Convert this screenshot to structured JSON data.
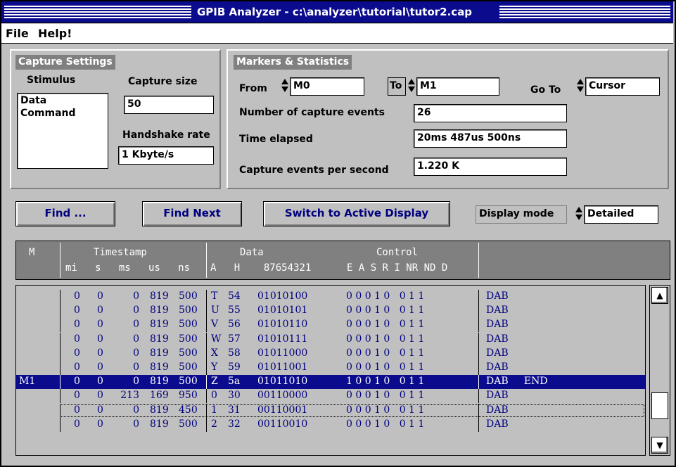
{
  "window": {
    "title": "GPIB Analyzer - c:\\analyzer\\tutorial\\tutor2.cap"
  },
  "menu": [
    {
      "label": "File"
    },
    {
      "label": "Help!"
    }
  ],
  "capture_settings": {
    "title": "Capture Settings",
    "stimulus_label": "Stimulus",
    "stimulus_items": [
      "Data",
      "Command"
    ],
    "capture_size_label": "Capture size",
    "capture_size_value": "50",
    "handshake_label": "Handshake rate",
    "handshake_value": "1 Kbyte/s"
  },
  "markers": {
    "title": "Markers & Statistics",
    "from_label": "From",
    "from_value": "M0",
    "to_label": "To",
    "to_value": "M1",
    "goto_label": "Go To",
    "goto_value": "Cursor",
    "events_label": "Number of capture events",
    "events_value": "26",
    "elapsed_label": "Time elapsed",
    "elapsed_value": "20ms 487us 500ns",
    "per_second_label": "Capture events per second",
    "per_second_value": "1.220 K"
  },
  "toolbar": {
    "find_label": "Find ...",
    "find_next_label": "Find Next",
    "switch_label": "Switch to Active Display",
    "display_mode_label": "Display mode",
    "display_mode_value": "Detailed"
  },
  "table": {
    "header": {
      "m": "M",
      "timestamp": "Timestamp",
      "timestamp_units": "mi   s   ms   us   ns",
      "data": "Data",
      "data_sub": "A   H    87654321",
      "control": "Control",
      "control_sub": "E A S R I NR ND D"
    },
    "rows": [
      {
        "m": "",
        "mi": "0",
        "s": "0",
        "ms": "0",
        "us": "819",
        "ns": "500",
        "a": "T",
        "h": "54",
        "bits": "01010100",
        "ctrl": "0 0 0 1 0   0 1 1",
        "desc": "DAB"
      },
      {
        "m": "",
        "mi": "0",
        "s": "0",
        "ms": "0",
        "us": "819",
        "ns": "500",
        "a": "U",
        "h": "55",
        "bits": "01010101",
        "ctrl": "0 0 0 1 0   0 1 1",
        "desc": "DAB"
      },
      {
        "m": "",
        "mi": "0",
        "s": "0",
        "ms": "0",
        "us": "819",
        "ns": "500",
        "a": "V",
        "h": "56",
        "bits": "01010110",
        "ctrl": "0 0 0 1 0   0 1 1",
        "desc": "DAB"
      },
      {
        "m": "",
        "mi": "0",
        "s": "0",
        "ms": "0",
        "us": "819",
        "ns": "500",
        "a": "W",
        "h": "57",
        "bits": "01010111",
        "ctrl": "0 0 0 1 0   0 1 1",
        "desc": "DAB"
      },
      {
        "m": "",
        "mi": "0",
        "s": "0",
        "ms": "0",
        "us": "819",
        "ns": "500",
        "a": "X",
        "h": "58",
        "bits": "01011000",
        "ctrl": "0 0 0 1 0   0 1 1",
        "desc": "DAB"
      },
      {
        "m": "",
        "mi": "0",
        "s": "0",
        "ms": "0",
        "us": "819",
        "ns": "500",
        "a": "Y",
        "h": "59",
        "bits": "01011001",
        "ctrl": "0 0 0 1 0   0 1 1",
        "desc": "DAB"
      },
      {
        "m": "M1",
        "mi": "0",
        "s": "0",
        "ms": "0",
        "us": "819",
        "ns": "500",
        "a": "Z",
        "h": "5a",
        "bits": "01011010",
        "ctrl": "1 0 0 1 0   0 1 1",
        "desc": "DAB     END"
      },
      {
        "m": "",
        "mi": "0",
        "s": "0",
        "ms": "213",
        "us": "169",
        "ns": "950",
        "a": "0",
        "h": "30",
        "bits": "00110000",
        "ctrl": "0 0 0 1 0   0 1 1",
        "desc": "DAB"
      },
      {
        "m": "",
        "mi": "0",
        "s": "0",
        "ms": "0",
        "us": "819",
        "ns": "450",
        "a": "1",
        "h": "31",
        "bits": "00110001",
        "ctrl": "0 0 0 1 0   0 1 1",
        "desc": "DAB"
      },
      {
        "m": "",
        "mi": "0",
        "s": "0",
        "ms": "0",
        "us": "819",
        "ns": "500",
        "a": "2",
        "h": "32",
        "bits": "00110010",
        "ctrl": "0 0 0 1 0   0 1 1",
        "desc": "DAB"
      }
    ],
    "selected_row": 6,
    "focus_row": 8
  },
  "icons": {
    "scroll_up": "up-arrow-icon",
    "scroll_down": "down-arrow-icon"
  }
}
